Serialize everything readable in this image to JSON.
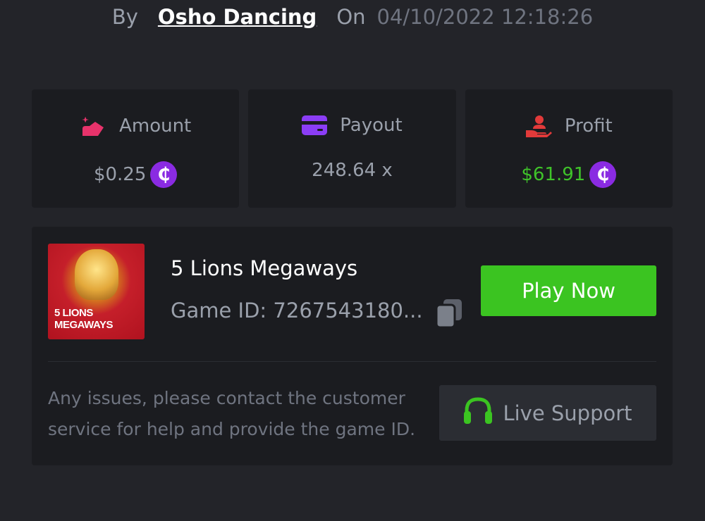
{
  "byline": {
    "by_label": "By",
    "username": "Osho Dancing",
    "on_label": "On",
    "datetime": "04/10/2022 12:18:26"
  },
  "stats": [
    {
      "label": "Amount",
      "value": "$0.25",
      "icon": "amount-icon",
      "icon_color": "#e7336b",
      "has_coin": true,
      "value_color": "#9aa0ab"
    },
    {
      "label": "Payout",
      "value": "248.64 x",
      "icon": "card-icon",
      "icon_color": "#8b3df5",
      "has_coin": false,
      "value_color": "#9aa0ab"
    },
    {
      "label": "Profit",
      "value": "$61.91",
      "icon": "hand-user-icon",
      "icon_color": "#e23a3a",
      "has_coin": true,
      "value_color": "#3fc32a"
    }
  ],
  "coin_symbol": "₵",
  "game": {
    "thumbnail_title_line1": "5 LIONS",
    "thumbnail_title_line2": "MEGAWAYS",
    "name": "5 Lions Megaways",
    "id_label": "Game ID: 7267543180...",
    "play_label": "Play Now"
  },
  "support": {
    "help_text": "Any issues, please contact the customer service for help and provide the game ID.",
    "button_label": "Live Support"
  },
  "colors": {
    "background": "#232429",
    "card": "#1b1c20",
    "play_button": "#3bc421",
    "support_icon": "#3bc421",
    "coin": "#8a2be2"
  }
}
